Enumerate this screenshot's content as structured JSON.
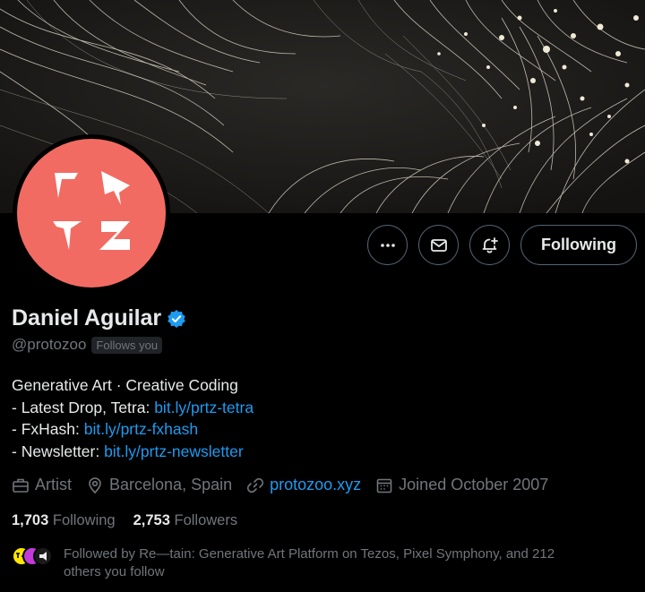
{
  "profile": {
    "name": "Daniel Aguilar",
    "handle": "@protozoo",
    "follows_you": "Follows you",
    "verified": true,
    "accent_color": "#1d9bf0",
    "avatar_color": "#f26b62"
  },
  "actions": {
    "more_icon": "more-icon",
    "message_icon": "envelope-icon",
    "notify_icon": "bell-plus-icon",
    "following_label": "Following"
  },
  "bio": {
    "line1": "Generative Art · Creative Coding",
    "line2_prefix": "- Latest Drop, Tetra: ",
    "line2_link": "bit.ly/prtz-tetra",
    "line3_prefix": "- FxHash: ",
    "line3_link": "bit.ly/prtz-fxhash",
    "line4_prefix": "- Newsletter: ",
    "line4_link": "bit.ly/prtz-newsletter"
  },
  "meta": {
    "category": "Artist",
    "location": "Barcelona, Spain",
    "website": "protozoo.xyz",
    "joined": "Joined October 2007"
  },
  "stats": {
    "following_count": "1,703",
    "following_label": "Following",
    "followers_count": "2,753",
    "followers_label": "Followers"
  },
  "followed_by": {
    "line1": "Followed by Re—tain: Generative Art Platform on Tezos, Pixel Symphony, and 212",
    "line2": "others you follow"
  }
}
